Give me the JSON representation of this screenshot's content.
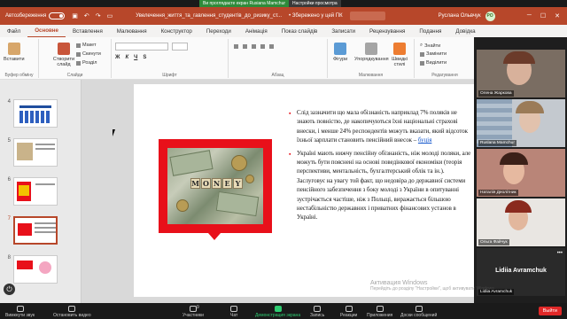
{
  "zoom_banner": {
    "sharing": "Ви проглядаєте екран Rusiana Mamchur",
    "view_options": "Настройки просмотра"
  },
  "titlebar": {
    "autosave_label": "Автозбереження",
    "autosave_state": "Вимк.",
    "document_name": "Увелечення_життя_та_гавлення_студентів_до_ризику_ст...",
    "saved_status": "• Збережено у цей ПК",
    "user_name": "Руслана Ольвчук",
    "user_initials": "РО"
  },
  "menu": {
    "tabs": [
      "Файл",
      "Основне",
      "Вставлення",
      "Малювання",
      "Конструктор",
      "Переходи",
      "Анімація",
      "Показ слайдів",
      "Записати",
      "Рецензування",
      "Подання",
      "Довідка"
    ],
    "active_index": 1
  },
  "ribbon": {
    "paste": "Вставити",
    "new_slide": "Створити слайд",
    "reuse": "Повторно використати слайди",
    "layout": "Макет",
    "reset": "Скинути",
    "section": "Розділ",
    "shapes": "Фігури",
    "arrange": "Упорядкування",
    "quick_styles": "Швидкі стилі",
    "find": "Знайти",
    "replace": "Замінити",
    "select": "Виділити",
    "groups": {
      "clipboard": "Буфер обміну",
      "slides": "Слайди",
      "font": "Шрифт",
      "paragraph": "Абзац",
      "drawing": "Малювання",
      "editing": "Редагування"
    }
  },
  "thumbnails": {
    "numbers": [
      "4",
      "5",
      "6",
      "7",
      "8"
    ],
    "selected": "7"
  },
  "slide": {
    "image_word": [
      "M",
      "O",
      "N",
      "E",
      "Y"
    ],
    "bullets": [
      {
        "text": "Слід зазначити що мала обізнаність наприклад 7% поляків не знають повністю, де накопичуються їхні національні страхові внески, і менше 24% респондентів можуть вказати, який відсоток їхньої зарплати становить пенсійний внесок –",
        "link": "буція"
      },
      {
        "text": "Україні мають нижчу пенсійну обізнаність, ніж молоді поляки, але можуть бути пояснені на основі поведінкової економіки (теорія перспективи, ментальність, бухгалтерський облік та ін.). Заслуговує на увагу той факт, що недовіра до державної системи пенсійного забезпечення з боку молоді з України в опитуванні зустрічається частіше, ніж з Польщі, виражається більшою нестабільністю державних і приватних фінансових установ в Україні.",
        "link": ""
      }
    ]
  },
  "participants": [
    {
      "name": "Олена Жаркова"
    },
    {
      "name": "Ruslana Mamchur"
    },
    {
      "name": "Наталія Деолітник"
    },
    {
      "name": "Ольга Файчук"
    },
    {
      "name": "Lidiia Avramchuk",
      "caption": "Lidiia Avramchuk"
    }
  ],
  "statusbar": {
    "mute": "Вимкнути звук",
    "video": "Остановить видео",
    "participants": "Участники",
    "participants_count": "9",
    "chat": "Чат",
    "share": "Демонстрация экрана",
    "record": "Запись",
    "reactions": "Реакции",
    "apps": "Приложения",
    "whiteboard": "Доски сообщений",
    "leave": "Выйти"
  },
  "watermark": {
    "title": "Активация Windows",
    "subtitle": "Перейдіть до розділу \"Настройки\", щоб активувати Windows."
  }
}
